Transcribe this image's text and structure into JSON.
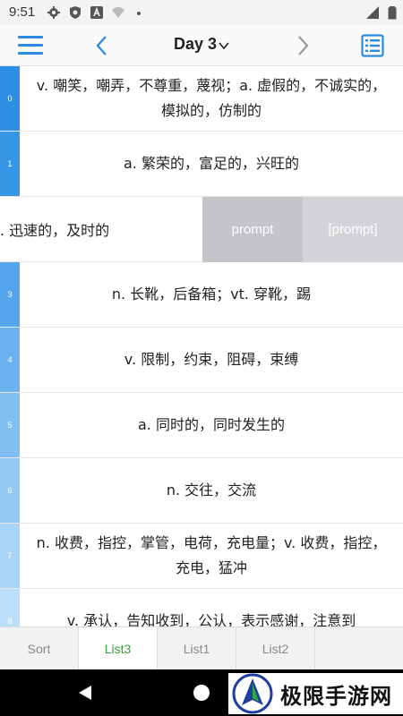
{
  "status_bar": {
    "time": "9:51"
  },
  "header": {
    "title": "Day 3"
  },
  "rows": [
    {
      "index": "0",
      "definition": "v. 嘲笑，嘲弄，不尊重，蔑视；a. 虚假的，不诚实的，模拟的，仿制的",
      "color": "#2e8fe5"
    },
    {
      "index": "1",
      "definition": "a. 繁荣的，富足的，兴旺的",
      "color": "#3896e7"
    },
    {
      "index": "",
      "definition": ". 迅速的，及时的",
      "color": "#ffffff"
    },
    {
      "index": "3",
      "definition": "n. 长靴，后备箱；vt. 穿靴，踢",
      "color": "#55a6ec"
    },
    {
      "index": "4",
      "definition": "v. 限制，约束，阻碍，束缚",
      "color": "#6bb2ef"
    },
    {
      "index": "5",
      "definition": "a. 同时的，同时发生的",
      "color": "#80bef2"
    },
    {
      "index": "6",
      "definition": "n. 交往，交流",
      "color": "#94c9f5"
    },
    {
      "index": "7",
      "definition": "n. 收费，指控，掌管，电荷，充电量；v. 收费，指控，充电，猛冲",
      "color": "#a8d4f7"
    },
    {
      "index": "8",
      "definition": "v. 承认，告知收到，公认，表示感谢，注意到",
      "color": "#bbdef9"
    }
  ],
  "swipe_actions": {
    "prompt_label": "prompt",
    "prompt_bracket_label": "[prompt]"
  },
  "tabs": [
    {
      "label": "Sort",
      "active": false
    },
    {
      "label": "List3",
      "active": true
    },
    {
      "label": "List1",
      "active": false
    },
    {
      "label": "List2",
      "active": false
    }
  ],
  "watermark": {
    "text": "极限手游网"
  },
  "colors": {
    "accent": "#2a8be0",
    "active_tab": "#3c9a3c"
  },
  "icons": [
    "settings-icon",
    "shield-icon",
    "a-icon",
    "wifi-icon",
    "signal-icon",
    "battery-icon",
    "menu-icon",
    "chevron-left-icon",
    "chevron-down-icon",
    "chevron-right-icon",
    "list-icon",
    "back-triangle-icon",
    "home-circle-icon"
  ]
}
